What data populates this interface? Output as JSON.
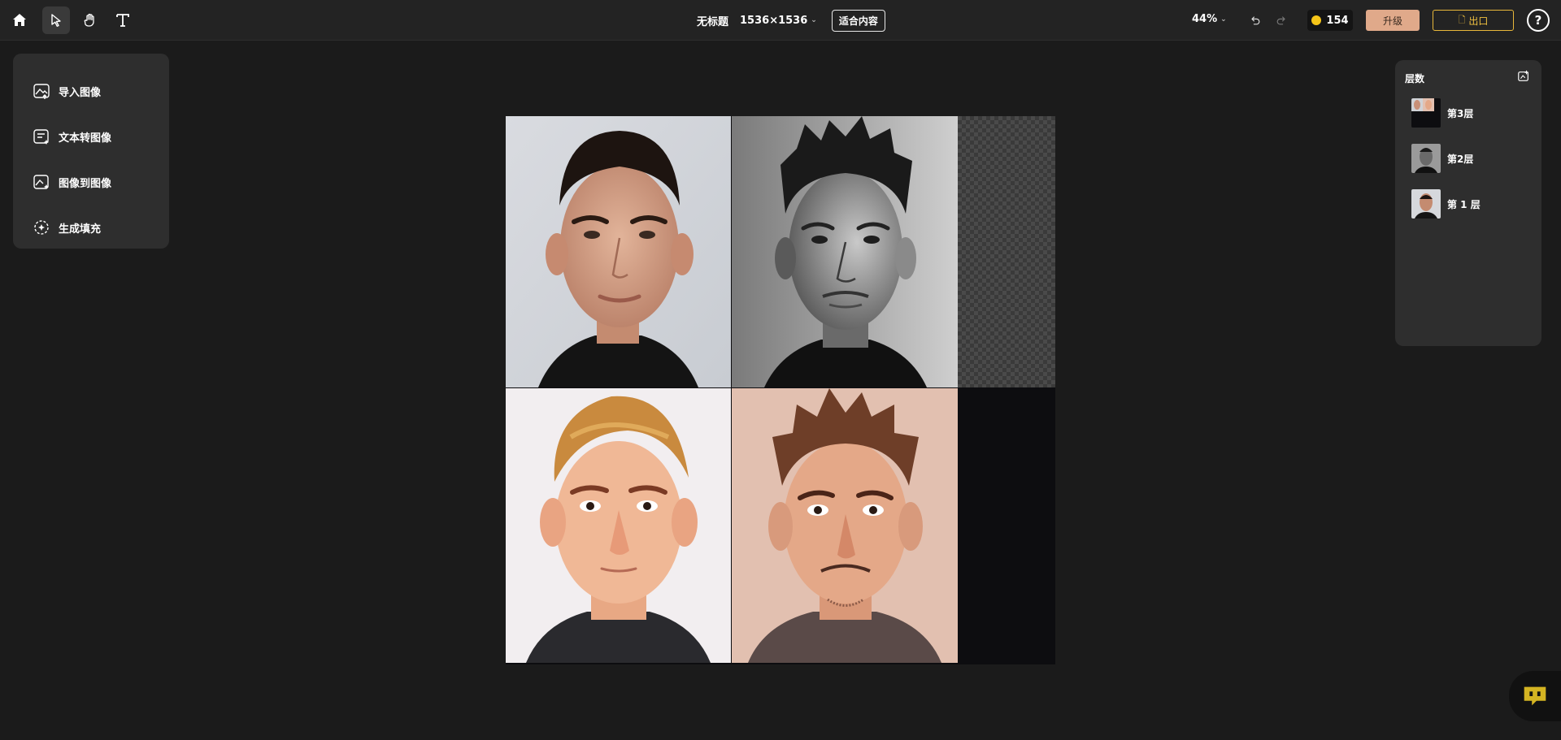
{
  "toolbar": {
    "tools": [
      "home-icon",
      "pointer-icon",
      "hand-icon",
      "text-icon"
    ],
    "doc_title": "无标题",
    "doc_size": "1536×1536",
    "fit_label": "适合内容",
    "zoom": "44%",
    "credits": "154",
    "upgrade_label": "升级",
    "export_label": "出口",
    "help_label": "?"
  },
  "left_panel": {
    "items": [
      {
        "label": "导入图像",
        "icon": "image-upload-icon"
      },
      {
        "label": "文本转图像",
        "icon": "text-to-image-icon"
      },
      {
        "label": "图像到图像",
        "icon": "image-to-image-icon"
      },
      {
        "label": "生成填充",
        "icon": "generative-fill-icon"
      }
    ]
  },
  "layers_panel": {
    "title": "层数",
    "layers": [
      {
        "label": "第3层"
      },
      {
        "label": "第2层"
      },
      {
        "label": "第 1 层"
      }
    ]
  },
  "colors": {
    "accent_gold": "#f0c040",
    "upgrade_bg": "#e0a98a",
    "panel_bg": "#2e2e2e",
    "app_bg": "#1b1b1b"
  }
}
